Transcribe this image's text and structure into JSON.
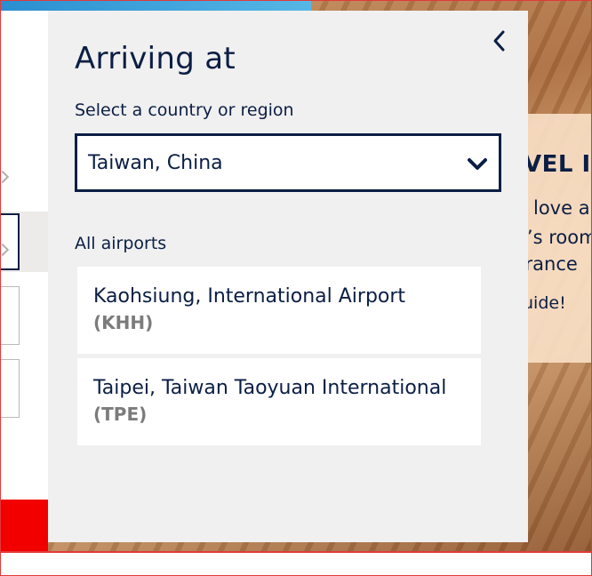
{
  "panel": {
    "title": "Arriving at",
    "back_icon": "chevron-left-icon",
    "region_label": "Select a country or region",
    "region_select": {
      "value": "Taiwan, China",
      "icon": "chevron-down-icon"
    },
    "airports_label": "All airports",
    "airports": [
      {
        "name": "Kaohsiung, International Airport",
        "code": "(KHH)"
      },
      {
        "name": "Taipei, Taiwan Taoyuan International",
        "code": "(TPE)"
      }
    ]
  },
  "background_card": {
    "title": "VEL IN",
    "lines": [
      "u love a",
      "e’s room",
      "France"
    ],
    "link": "uide!"
  },
  "colors": {
    "text_primary": "#0b1e44",
    "panel_bg": "#f0f0f0",
    "code_gray": "#7b7b7b",
    "accent_red": "#f20000"
  }
}
